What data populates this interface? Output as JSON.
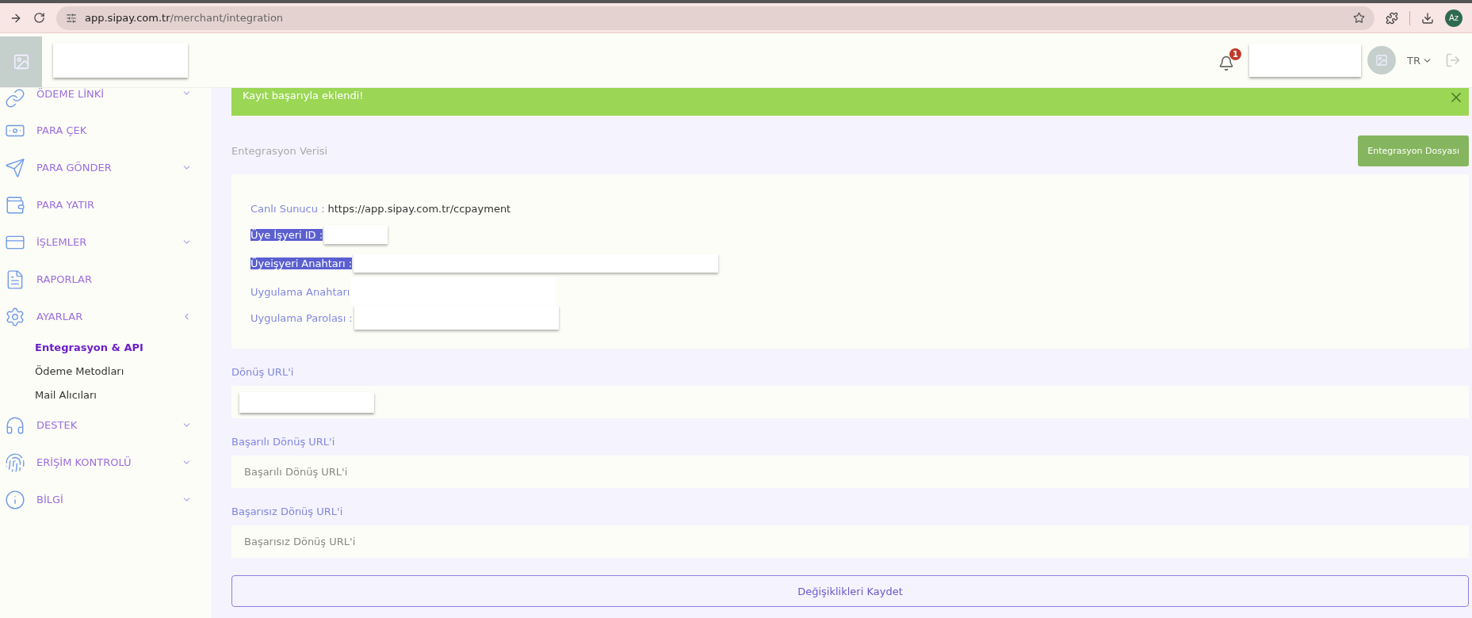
{
  "browser": {
    "url_host": "app.sipay.com.tr",
    "url_path": "/merchant/integration",
    "profile": "Az"
  },
  "header": {
    "notification_count": "1",
    "language": "TR"
  },
  "sidebar": {
    "items": [
      {
        "label": "ÖDEME LİNKİ",
        "kind": "group",
        "expanded": false
      },
      {
        "label": "PARA ÇEK",
        "kind": "link"
      },
      {
        "label": "PARA GÖNDER",
        "kind": "group",
        "expanded": false
      },
      {
        "label": "PARA YATIR",
        "kind": "link"
      },
      {
        "label": "İŞLEMLER",
        "kind": "group",
        "expanded": false
      },
      {
        "label": "RAPORLAR",
        "kind": "link"
      },
      {
        "label": "AYARLAR",
        "kind": "group",
        "expanded": true,
        "children": [
          {
            "label": "Entegrasyon & API",
            "selected": true
          },
          {
            "label": "Ödeme Metodları",
            "selected": false
          },
          {
            "label": "Mail Alıcıları",
            "selected": false
          }
        ]
      },
      {
        "label": "DESTEK",
        "kind": "group",
        "expanded": false
      },
      {
        "label": "ERİŞİM KONTROLÜ",
        "kind": "group",
        "expanded": false
      },
      {
        "label": "BİLGİ",
        "kind": "group",
        "expanded": false
      }
    ]
  },
  "alert": {
    "message": "Kayıt başarıyla eklendi!"
  },
  "integration": {
    "title": "Entegrasyon Verisi",
    "file_button": "Entegrasyon Dosyası",
    "rows": [
      {
        "label": "Canlı Sunucu :",
        "value": "https://app.sipay.com.tr/ccpayment",
        "highlighted": false
      },
      {
        "label": "Üye İşyeri ID :",
        "highlighted": true,
        "masked": true
      },
      {
        "label": "Üyeişyeri Anahtarı :",
        "highlighted": true,
        "masked": true
      },
      {
        "label": "Uygulama Anahtarı",
        "highlighted": false,
        "masked": true
      },
      {
        "label": "Uygulama Parolası :",
        "highlighted": false,
        "masked": true
      }
    ]
  },
  "url_fields": [
    {
      "label": "Dönüş URL'i",
      "masked": true
    },
    {
      "label": "Başarılı Dönüş URL'i",
      "placeholder": "Başarılı Dönüş URL'i"
    },
    {
      "label": "Başarısız Dönüş URL'i",
      "placeholder": "Başarısız Dönüş URL'i"
    }
  ],
  "save_button": "Değişiklikleri Kaydet"
}
